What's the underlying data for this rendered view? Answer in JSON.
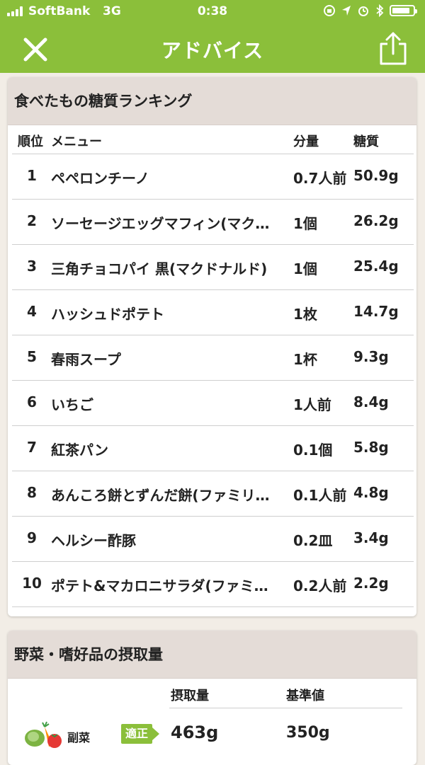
{
  "status_bar": {
    "carrier": "SoftBank",
    "network": "3G",
    "time": "0:38"
  },
  "nav": {
    "title": "アドバイス",
    "close_icon": "close-icon",
    "share_icon": "share-icon"
  },
  "colors": {
    "brand_green": "#8bbf3a",
    "header_bg": "#e4dcd7",
    "page_bg": "#f2ede6"
  },
  "ranking": {
    "title": "食べたもの糖質ランキング",
    "headers": {
      "rank": "順位",
      "menu": "メニュー",
      "qty": "分量",
      "carb": "糖質"
    },
    "rows": [
      {
        "rank": "1",
        "menu": "ペペロンチーノ",
        "qty": "0.7人前",
        "carb": "50.9g"
      },
      {
        "rank": "2",
        "menu": "ソーセージエッグマフィン(マク…",
        "qty": "1個",
        "carb": "26.2g"
      },
      {
        "rank": "3",
        "menu": "三角チョコパイ 黒(マクドナルド)",
        "qty": "1個",
        "carb": "25.4g"
      },
      {
        "rank": "4",
        "menu": "ハッシュドポテト",
        "qty": "1枚",
        "carb": "14.7g"
      },
      {
        "rank": "5",
        "menu": "春雨スープ",
        "qty": "1杯",
        "carb": "9.3g"
      },
      {
        "rank": "6",
        "menu": "いちご",
        "qty": "1人前",
        "carb": "8.4g"
      },
      {
        "rank": "7",
        "menu": "紅茶パン",
        "qty": "0.1個",
        "carb": "5.8g"
      },
      {
        "rank": "8",
        "menu": "あんころ餅とずんだ餅(ファミリ…",
        "qty": "0.1人前",
        "carb": "4.8g"
      },
      {
        "rank": "9",
        "menu": "ヘルシー酢豚",
        "qty": "0.2皿",
        "carb": "3.4g"
      },
      {
        "rank": "10",
        "menu": "ポテト&マカロニサラダ(ファミ…",
        "qty": "0.2人前",
        "carb": "2.2g"
      }
    ]
  },
  "vegetables": {
    "title": "野菜・嗜好品の摂取量",
    "headers": {
      "intake": "摂取量",
      "standard": "基準値"
    },
    "rows": [
      {
        "label": "副菜",
        "icon": "vegetables-icon",
        "badge": "適正",
        "intake": "463g",
        "standard": "350g"
      }
    ]
  }
}
